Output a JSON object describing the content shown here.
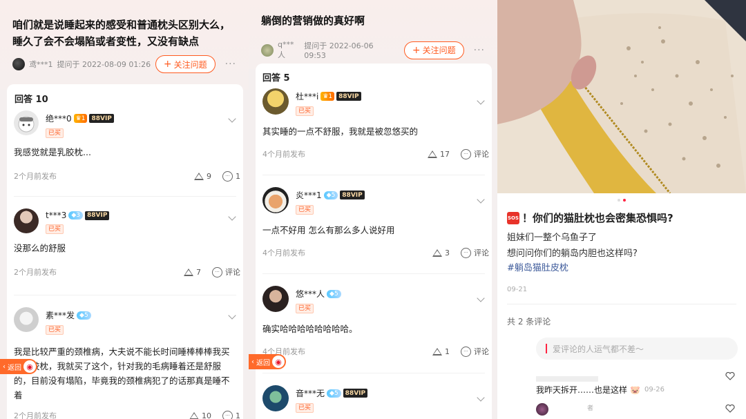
{
  "panel1": {
    "question": "咱们就是说睡起来的感受和普通枕头区别大么，睡久了会不会塌陷或者变性，又没有缺点",
    "asker": "鸢***1",
    "asked_at": "提问于 2022-08-09 01:26",
    "follow_label": "关注问题",
    "answers_label": "回答 10",
    "answers": [
      {
        "user": "绝***0",
        "level": "1",
        "vip": "88VIP",
        "bought": "已买",
        "text": "我感觉就是乳胶枕...",
        "time": "2个月前发布",
        "likes": "9",
        "comments": "1"
      },
      {
        "user": "t***3",
        "level": "3",
        "vip": "88VIP",
        "bought": "已买",
        "text": "没那么的舒服",
        "time": "2个月前发布",
        "likes": "7",
        "comments": "评论"
      },
      {
        "user": "素***发",
        "level": "5",
        "vip": "",
        "bought": "已买",
        "text": "我是比较严重的颈椎病，大夫说不能长时间睡棒棒棒我买个乳胶枕，我就买了这个，针对我的毛病睡着还是舒服的，目前没有塌陷，毕竟我的颈椎病犯了的话那真是睡不着",
        "time": "2个月前发布",
        "likes": "10",
        "comments": "1"
      }
    ],
    "back_label": "返回"
  },
  "panel2": {
    "question": "躺倒的营销做的真好啊",
    "asker": "q***人",
    "asked_at": "提问于 2022-06-06 09:53",
    "follow_label": "关注问题",
    "answers_label": "回答 5",
    "answers": [
      {
        "user": "杜***i",
        "level": "1",
        "vip": "88VIP",
        "bought": "已买",
        "text": "其实睡的一点不舒服，我就是被忽悠买的",
        "time": "4个月前发布",
        "likes": "17",
        "comments": "评论"
      },
      {
        "user": "炎***1",
        "level": "5",
        "vip": "88VIP",
        "bought": "已买",
        "text": "一点不好用 怎么有那么多人说好用",
        "time": "4个月前发布",
        "likes": "3",
        "comments": "评论"
      },
      {
        "user": "悠***人",
        "level": "5",
        "vip": "",
        "bought": "已买",
        "text": "确实哈哈哈哈哈哈哈哈。",
        "time": "4个月前发布",
        "likes": "1",
        "comments": "评论"
      },
      {
        "user": "音***无",
        "level": "5",
        "vip": "88VIP",
        "bought": "已买"
      }
    ],
    "back_label": "返回"
  },
  "panel3": {
    "sos": "SOS",
    "title": "！你们的猫肚枕也会密集恐惧吗?",
    "line1": "姐妹们一整个乌鱼子了",
    "line2": "想问问你们的躺岛内胆也这样吗?",
    "tag": "#躺岛猫肚皮枕",
    "date": "09-21",
    "comment_count": "共 2 条评论",
    "comment_placeholder": "爱评论的人运气都不差～",
    "comment1_text": "我昨天拆开……也是这样",
    "comment1_date": "09-26",
    "comment2_user": "者"
  },
  "colors": {
    "accent": "#ff5a1f",
    "tag": "#3d5a9a",
    "like_heart": "#ff2442"
  }
}
